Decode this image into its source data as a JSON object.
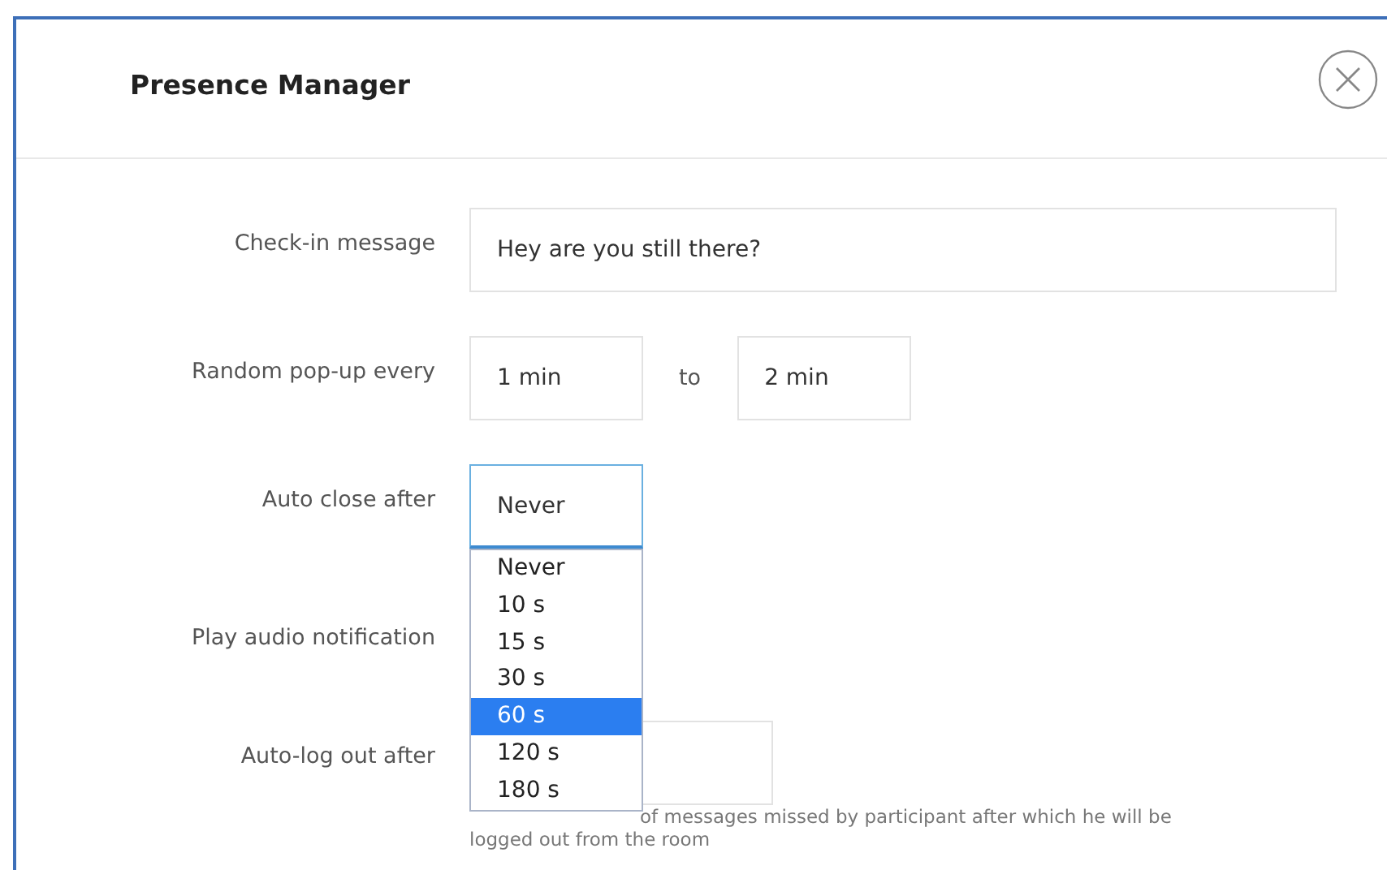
{
  "dialog": {
    "title": "Presence Manager"
  },
  "check_in": {
    "label": "Check-in message",
    "value": "Hey are you still there?"
  },
  "random_popup": {
    "label": "Random pop-up every",
    "from": "1 min",
    "separator": "to",
    "to": "2 min"
  },
  "auto_close": {
    "label": "Auto close after",
    "value": "Never",
    "expanded": true,
    "options": [
      {
        "label": "Never",
        "highlighted": false
      },
      {
        "label": "10 s",
        "highlighted": false
      },
      {
        "label": "15 s",
        "highlighted": false
      },
      {
        "label": "30 s",
        "highlighted": false
      },
      {
        "label": "60 s",
        "highlighted": true
      },
      {
        "label": "120 s",
        "highlighted": false
      },
      {
        "label": "180 s",
        "highlighted": false
      }
    ]
  },
  "audio_notification": {
    "label": "Play audio notification"
  },
  "auto_logout": {
    "label": "Auto-log out after",
    "help_line_1": "of messages missed by participant after which he will be",
    "help_line_2": "logged out from the room"
  }
}
